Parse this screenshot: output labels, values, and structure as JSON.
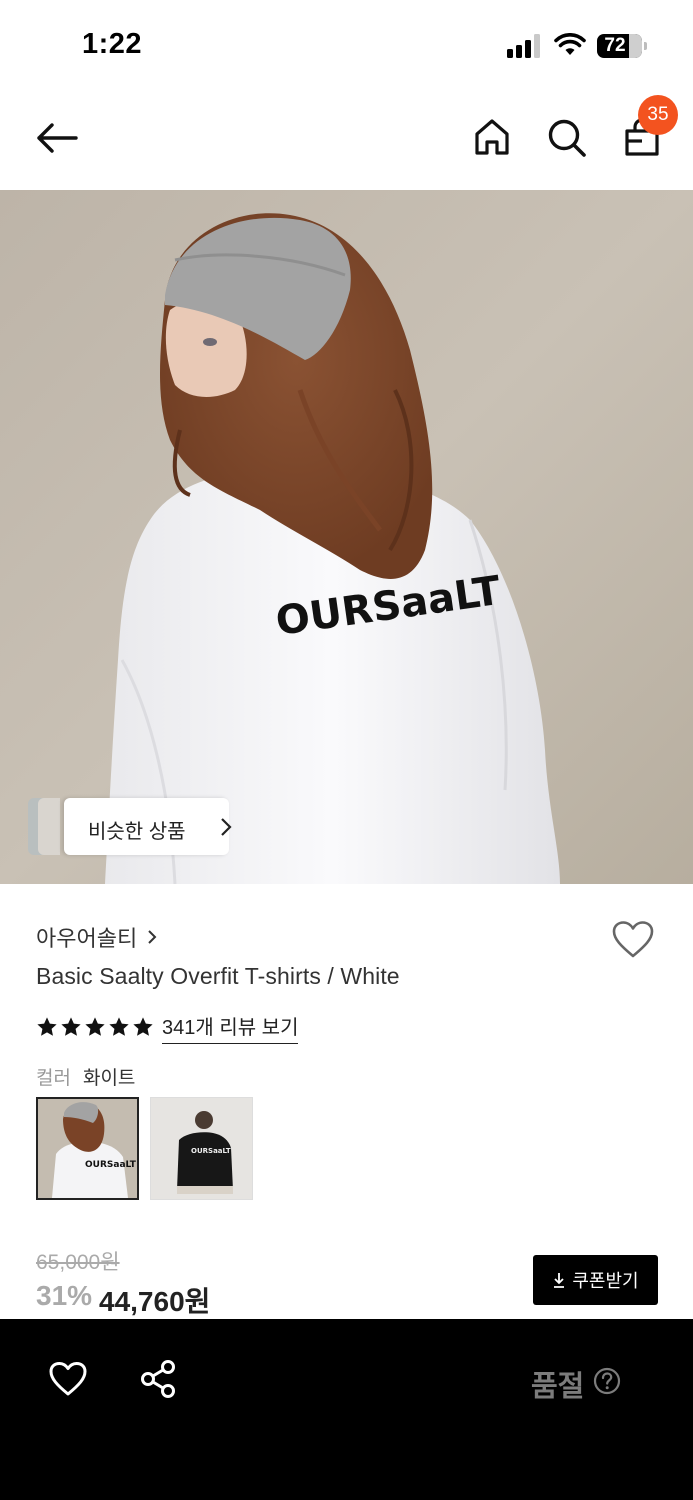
{
  "status_bar": {
    "time": "1:22",
    "battery": "72",
    "battery_level": 0.72
  },
  "header": {
    "back_icon": "arrow-left-icon",
    "home_icon": "home-icon",
    "search_icon": "search-icon",
    "cart_icon": "shopping-bag-icon",
    "cart_count": "35"
  },
  "hero": {
    "image": "model-white-tshirt-photo",
    "shirt_print": "OURSaaLT",
    "similar_button_label": "비슷한 상품"
  },
  "product": {
    "brand": "아우어솔티",
    "title": "Basic Saalty Overfit T-shirts / White",
    "rating": 5,
    "review_link": "341개 리뷰 보기",
    "color_label": "컬러",
    "color_value": "화이트"
  },
  "swatches": [
    {
      "color": "white",
      "selected": true,
      "print": "OURSaaLT"
    },
    {
      "color": "black",
      "selected": false,
      "print": "OURSaaLT"
    }
  ],
  "price": {
    "original": "65,000원",
    "discount": "31%",
    "sale": "44,760원"
  },
  "coupon": {
    "icon": "download-icon",
    "label": "쿠폰받기"
  },
  "bottom_bar": {
    "wishlist_icon": "heart-icon",
    "share_icon": "share-icon",
    "status": "품절",
    "help_icon": "question-circle-icon"
  },
  "colors": {
    "badge": "#f3531f",
    "bar": "#000000",
    "muted": "#aaaaaa"
  }
}
